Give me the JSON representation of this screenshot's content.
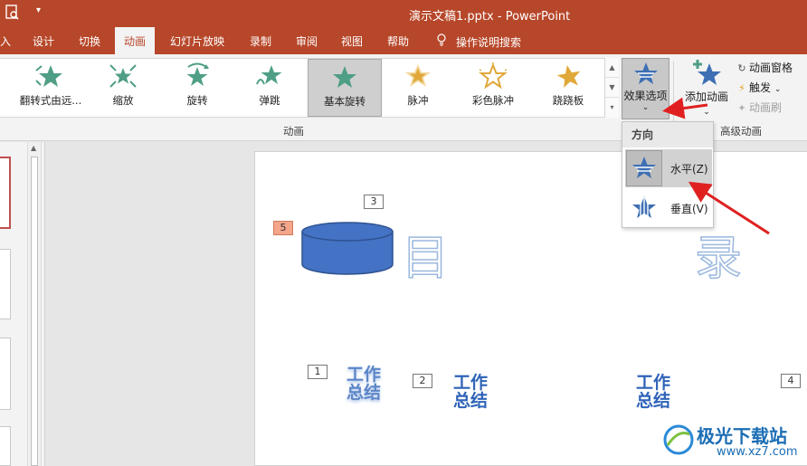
{
  "titlebar": {
    "doc_name": "演示文稿1.pptx",
    "separator": "-",
    "app_name": "PowerPoint",
    "qa_icon": "document-preview-icon",
    "qa_dropdown": "▾"
  },
  "tabs": [
    {
      "label": "入"
    },
    {
      "label": "设计"
    },
    {
      "label": "切换"
    },
    {
      "label": "动画",
      "active": true
    },
    {
      "label": "幻灯片放映"
    },
    {
      "label": "录制"
    },
    {
      "label": "审阅"
    },
    {
      "label": "视图"
    },
    {
      "label": "帮助"
    },
    {
      "label": "操作说明搜索",
      "icon": "lightbulb-icon"
    }
  ],
  "ribbon": {
    "animations": [
      {
        "label": "翻转式由远...",
        "icon": "flip-star-icon",
        "color": "#4f9e86"
      },
      {
        "label": "缩放",
        "icon": "zoom-star-icon",
        "color": "#4f9e86"
      },
      {
        "label": "旋转",
        "icon": "spin-star-icon",
        "color": "#4f9e86"
      },
      {
        "label": "弹跳",
        "icon": "bounce-star-icon",
        "color": "#4f9e86"
      },
      {
        "label": "基本旋转",
        "icon": "basic-swivel-star-icon",
        "color": "#4f9e86",
        "selected": true
      },
      {
        "label": "脉冲",
        "icon": "pulse-star-icon",
        "color": "#e0a83a"
      },
      {
        "label": "彩色脉冲",
        "icon": "color-pulse-star-icon",
        "color": "#e0a83a"
      },
      {
        "label": "跷跷板",
        "icon": "teeter-star-icon",
        "color": "#e0a83a"
      }
    ],
    "gallery_scroll": [
      "▲",
      "▼",
      "▾"
    ],
    "effect_options": {
      "label": "效果选项",
      "chevron": "⌄"
    },
    "add_animation": {
      "label": "添加动画",
      "chevron": "⌄"
    },
    "advanced": [
      {
        "label": "动画窗格",
        "icon": "animation-pane-icon",
        "disabled": false
      },
      {
        "label": "触发",
        "icon": "trigger-icon",
        "suffix": "⌄",
        "disabled": false
      },
      {
        "label": "动画刷",
        "icon": "animation-painter-icon",
        "disabled": true
      }
    ],
    "group_labels": {
      "animation": "动画",
      "advanced": "高级动画"
    }
  },
  "dropdown": {
    "header": "方向",
    "items": [
      {
        "label": "水平(Z)",
        "icon": "horizontal-star-icon",
        "selected": true
      },
      {
        "label": "垂直(V)",
        "icon": "vertical-star-icon",
        "selected": false
      }
    ]
  },
  "slide": {
    "tags": [
      "1",
      "2",
      "3",
      "4",
      "5"
    ],
    "outline_text": [
      "目",
      "录"
    ],
    "word_art": [
      "工作",
      "总结"
    ],
    "shape_color": "#4472c4"
  },
  "watermark": {
    "title": "极光下载站",
    "url": "www.xz7.com"
  },
  "colors": {
    "brand": "#b7472a",
    "arrow": "#e02020",
    "accent_blue": "#2f63b8"
  }
}
